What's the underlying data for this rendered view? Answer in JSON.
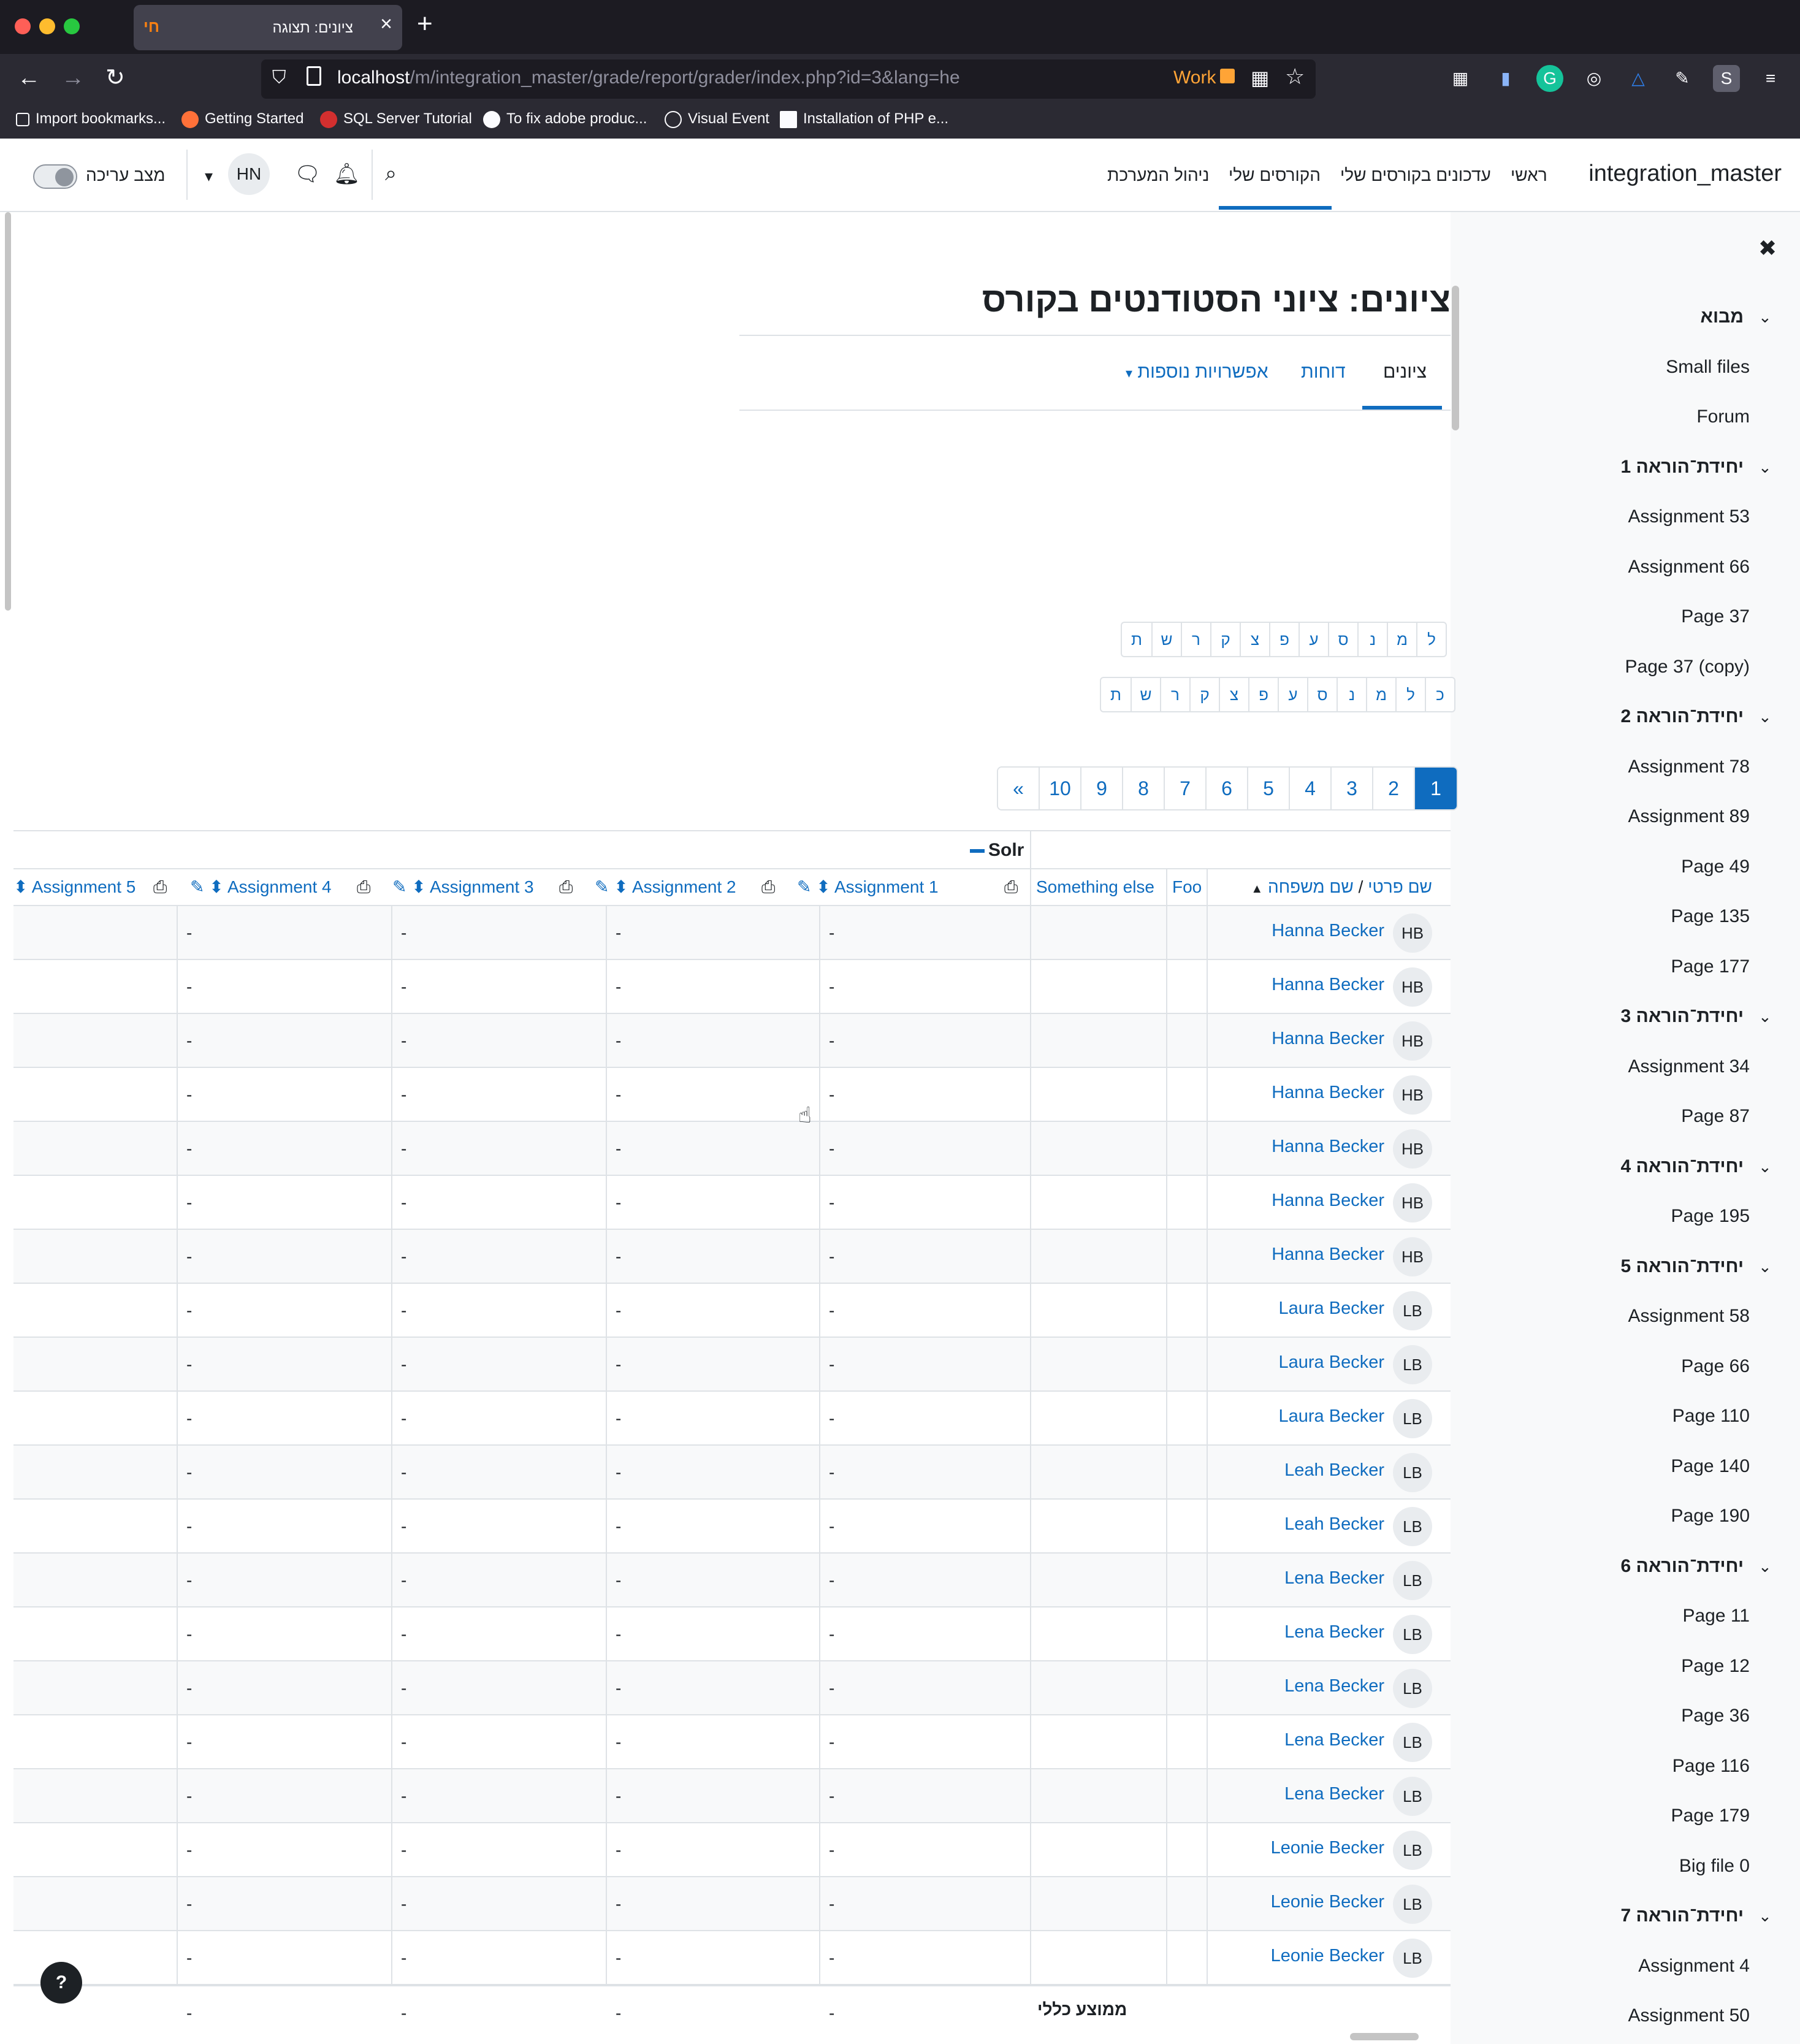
{
  "browser": {
    "tab_title": "ציונים: תצוגה",
    "tab_favicon": "חי",
    "url_host": "localhost",
    "url_path": "/m/integration_master/grade/report/grader/index.php?id=3&lang=he",
    "container_label": "Work",
    "bookmarks": [
      "Import bookmarks...",
      "Getting Started",
      "SQL Server Tutorial",
      "To fix adobe produc...",
      "Visual Event",
      "Installation of PHP e..."
    ]
  },
  "header": {
    "site_name": "integration_master",
    "nav": [
      "ראשי",
      "עדכונים בקורסים שלי",
      "הקורסים שלי",
      "ניהול המערכת"
    ],
    "avatar_initials": "HN",
    "edit_mode_label": "מצב עריכה"
  },
  "course_index": [
    {
      "type": "section",
      "label": "מבוא"
    },
    {
      "type": "item",
      "label": "Small files"
    },
    {
      "type": "item",
      "label": "Forum"
    },
    {
      "type": "section",
      "label": "יחידת־הוראה 1"
    },
    {
      "type": "item",
      "label": "Assignment 53"
    },
    {
      "type": "item",
      "label": "Assignment 66"
    },
    {
      "type": "item",
      "label": "Page 37"
    },
    {
      "type": "item",
      "label": "Page 37 (copy)"
    },
    {
      "type": "section",
      "label": "יחידת־הוראה 2"
    },
    {
      "type": "item",
      "label": "Assignment 78"
    },
    {
      "type": "item",
      "label": "Assignment 89"
    },
    {
      "type": "item",
      "label": "Page 49"
    },
    {
      "type": "item",
      "label": "Page 135"
    },
    {
      "type": "item",
      "label": "Page 177"
    },
    {
      "type": "section",
      "label": "יחידת־הוראה 3"
    },
    {
      "type": "item",
      "label": "Assignment 34"
    },
    {
      "type": "item",
      "label": "Page 87"
    },
    {
      "type": "section",
      "label": "יחידת־הוראה 4"
    },
    {
      "type": "item",
      "label": "Page 195"
    },
    {
      "type": "section",
      "label": "יחידת־הוראה 5"
    },
    {
      "type": "item",
      "label": "Assignment 58"
    },
    {
      "type": "item",
      "label": "Page 66"
    },
    {
      "type": "item",
      "label": "Page 110"
    },
    {
      "type": "item",
      "label": "Page 140"
    },
    {
      "type": "item",
      "label": "Page 190"
    },
    {
      "type": "section",
      "label": "יחידת־הוראה 6"
    },
    {
      "type": "item",
      "label": "Page 11"
    },
    {
      "type": "item",
      "label": "Page 12"
    },
    {
      "type": "item",
      "label": "Page 36"
    },
    {
      "type": "item",
      "label": "Page 116"
    },
    {
      "type": "item",
      "label": "Page 179"
    },
    {
      "type": "item",
      "label": "Big file 0"
    },
    {
      "type": "section",
      "label": "יחידת־הוראה 7"
    },
    {
      "type": "item",
      "label": "Assignment 4"
    },
    {
      "type": "item",
      "label": "Assignment 50"
    }
  ],
  "page": {
    "title": "ציונים: ציוני הסטודנטים בקורס",
    "tabs": [
      "ציונים",
      "דוחות",
      "אפשרויות נוספות"
    ],
    "firstname_letters": [
      "ל",
      "מ",
      "נ",
      "ס",
      "ע",
      "פ",
      "צ",
      "ק",
      "ר",
      "ש",
      "ת"
    ],
    "lastname_letters": [
      "כ",
      "ל",
      "מ",
      "נ",
      "ס",
      "ע",
      "פ",
      "צ",
      "ק",
      "ר",
      "ש",
      "ת"
    ],
    "pages": [
      "«",
      "10",
      "9",
      "8",
      "7",
      "6",
      "5",
      "4",
      "3",
      "2",
      "1"
    ],
    "active_page": "1"
  },
  "grader": {
    "category": "Solr",
    "name_header_first": "שם פרטי",
    "name_header_sep": "/",
    "name_header_last": "שם משפחה",
    "columns": [
      "Assignment 5",
      "Assignment 4",
      "Assignment 3",
      "Assignment 2",
      "Assignment 1",
      "Something else",
      "Foo"
    ],
    "empty_value": "-",
    "students": [
      {
        "initials": "HB",
        "name": "Hanna Becker"
      },
      {
        "initials": "HB",
        "name": "Hanna Becker"
      },
      {
        "initials": "HB",
        "name": "Hanna Becker"
      },
      {
        "initials": "HB",
        "name": "Hanna Becker"
      },
      {
        "initials": "HB",
        "name": "Hanna Becker"
      },
      {
        "initials": "HB",
        "name": "Hanna Becker"
      },
      {
        "initials": "HB",
        "name": "Hanna Becker"
      },
      {
        "initials": "LB",
        "name": "Laura Becker"
      },
      {
        "initials": "LB",
        "name": "Laura Becker"
      },
      {
        "initials": "LB",
        "name": "Laura Becker"
      },
      {
        "initials": "LB",
        "name": "Leah Becker"
      },
      {
        "initials": "LB",
        "name": "Leah Becker"
      },
      {
        "initials": "LB",
        "name": "Lena Becker"
      },
      {
        "initials": "LB",
        "name": "Lena Becker"
      },
      {
        "initials": "LB",
        "name": "Lena Becker"
      },
      {
        "initials": "LB",
        "name": "Lena Becker"
      },
      {
        "initials": "LB",
        "name": "Lena Becker"
      },
      {
        "initials": "LB",
        "name": "Leonie Becker"
      },
      {
        "initials": "LB",
        "name": "Leonie Becker"
      },
      {
        "initials": "LB",
        "name": "Leonie Becker"
      }
    ],
    "overall_average_label": "ממוצע כללי"
  },
  "help_label": "?"
}
